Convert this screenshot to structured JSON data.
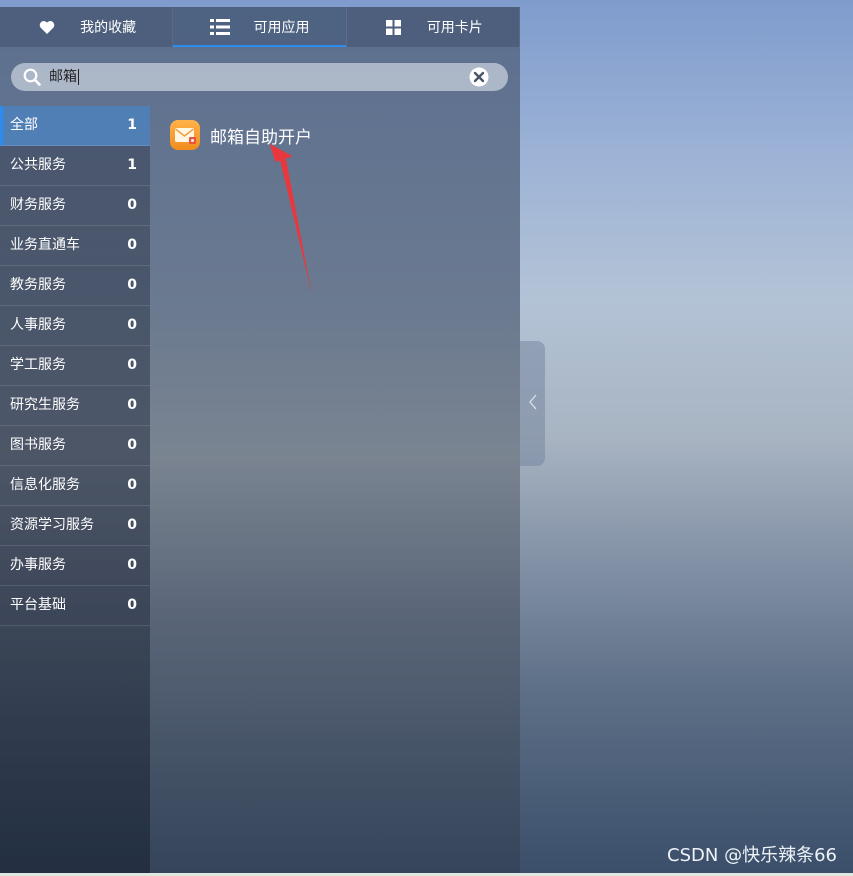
{
  "tabs": [
    {
      "label": "我的收藏",
      "icon": "heart-icon"
    },
    {
      "label": "可用应用",
      "icon": "list-icon"
    },
    {
      "label": "可用卡片",
      "icon": "grid-icon"
    }
  ],
  "search": {
    "value": "邮箱"
  },
  "categories": [
    {
      "name": "全部",
      "count": "1"
    },
    {
      "name": "公共服务",
      "count": "1"
    },
    {
      "name": "财务服务",
      "count": "0"
    },
    {
      "name": "业务直通车",
      "count": "0"
    },
    {
      "name": "教务服务",
      "count": "0"
    },
    {
      "name": "人事服务",
      "count": "0"
    },
    {
      "name": "学工服务",
      "count": "0"
    },
    {
      "name": "研究生服务",
      "count": "0"
    },
    {
      "name": "图书服务",
      "count": "0"
    },
    {
      "name": "信息化服务",
      "count": "0"
    },
    {
      "name": "资源学习服务",
      "count": "0"
    },
    {
      "name": "办事服务",
      "count": "0"
    },
    {
      "name": "平台基础",
      "count": "0"
    }
  ],
  "apps": [
    {
      "name": "邮箱自助开户",
      "icon": "mail-icon"
    }
  ],
  "watermark": "CSDN @快乐辣条66",
  "colors": {
    "accent": "#2d8cf0",
    "arrow": "#e8383d",
    "app_icon": "#f5a132"
  }
}
